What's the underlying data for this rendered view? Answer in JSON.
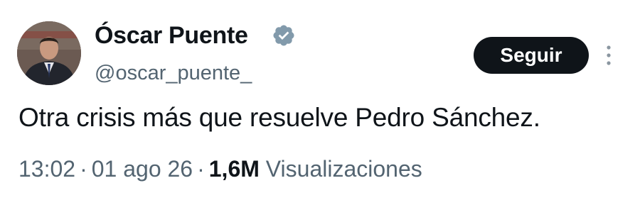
{
  "author": {
    "display_name": "Óscar Puente",
    "handle": "@oscar_puente_",
    "verified_icon": "verified-badge-icon",
    "badge_color": "#829aab"
  },
  "actions": {
    "follow_label": "Seguir",
    "more_icon": "more-vertical-icon"
  },
  "tweet": {
    "text": "Otra crisis más que resuelve Pedro Sánchez."
  },
  "meta": {
    "time": "13:02",
    "separator": "·",
    "date": "01 ago 26",
    "views_count": "1,6M",
    "views_label": "Visualizaciones"
  },
  "colors": {
    "text": "#0f1419",
    "secondary": "#536471",
    "button_bg": "#0f1419"
  }
}
